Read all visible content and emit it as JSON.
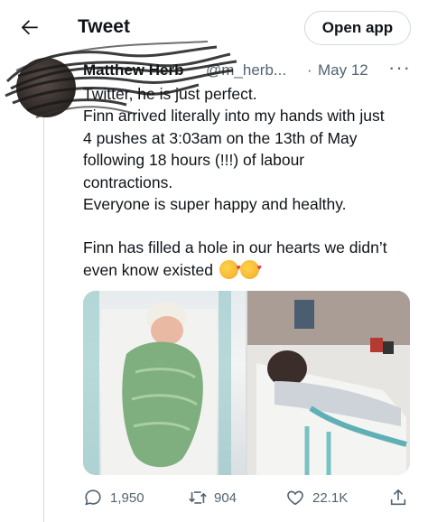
{
  "topbar": {
    "title": "Tweet",
    "open_app_label": "Open app"
  },
  "tweet": {
    "author_name": "Matthew Herb",
    "handle": "@m_herb...",
    "separator": "·",
    "date": "May 12",
    "more": "···",
    "lines": [
      "Twitter, he is just perfect.",
      "Finn arrived literally into my hands with just",
      "4 pushes at 3:03am on the 13th of May",
      "following 18 hours (!!!) of labour",
      "contractions.",
      "Everyone is super happy and healthy.",
      "Finn has filled a hole in our hearts we didn’t",
      "even know existed"
    ],
    "emoji": [
      "smiling-face-with-hearts",
      "smiling-face-with-hearts"
    ]
  },
  "actions": {
    "replies": "1,950",
    "retweets": "904",
    "likes": "22.1K"
  },
  "colors": {
    "text": "#0f1419",
    "secondary": "#536471",
    "border": "#cfd9de",
    "baby_wrap": "#7fae7f"
  }
}
